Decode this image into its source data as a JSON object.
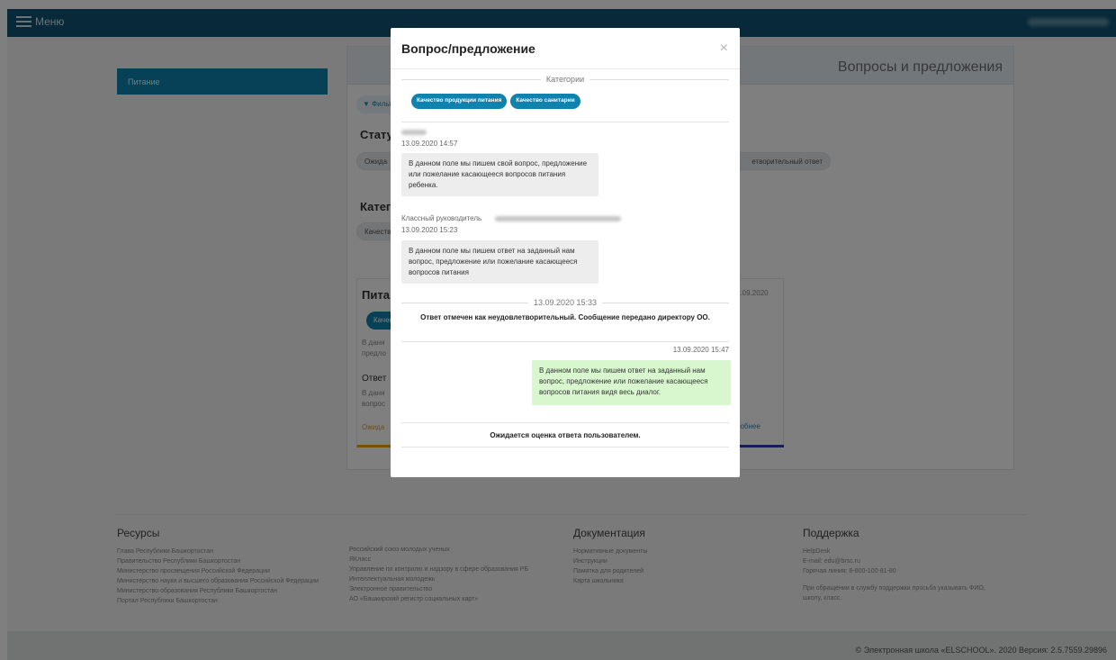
{
  "topbar": {
    "menu_label": "Меню"
  },
  "sidebar": {
    "items": [
      {
        "label": "Питание"
      }
    ]
  },
  "background": {
    "panel_title": "Вопросы и предложения",
    "filter_label": "Фильт",
    "status_heading": "Стату",
    "status_pill_left": "Ожида",
    "status_pill_right": "етворительный ответ",
    "category_heading": "Катего",
    "category_pill": "Качеств",
    "card_title": "Пита",
    "card_date": "9.09.2020",
    "card_chip": "Качес",
    "card_text_1": "В данн",
    "card_text_2": "предло",
    "card_answer": "Ответ",
    "card_answer_text_1": "В данн",
    "card_answer_text_2": "вопрос",
    "card_status": "Ожида",
    "card_more": "робнее"
  },
  "modal": {
    "title": "Вопрос/предложение",
    "close_label": "×",
    "categories_label": "Категории",
    "categories": [
      "Качество продукции питания",
      "Качество санитарии"
    ],
    "messages": [
      {
        "author_prefix": "",
        "time": "13.09.2020 14:57",
        "text": "В данном поле мы пишем свой вопрос, предложение или пожелание касающееся вопросов питания ребенка."
      },
      {
        "author_prefix": "Классный руководитель",
        "time": "13.09.2020 15:23",
        "text": "В данном поле мы пишем ответ на заданный нам вопрос, предложение или пожелание касающееся вопросов питания"
      }
    ],
    "system_event": {
      "time": "13.09.2020 15:33",
      "text": "Ответ отмечен как неудовлетворительный. Сообщение передано директору ОО."
    },
    "own_message": {
      "time": "13.09.2020 15:47",
      "text": "В данном поле мы пишем ответ на заданный нам вопрос, предложение или пожелание касающееся вопросов питания видя весь диалог."
    },
    "footer_text": "Ожидается оценка ответа пользователем."
  },
  "footer": {
    "resources": {
      "title": "Ресурсы",
      "links_col1": [
        "Глава Республики Башкортостан",
        "Правительство Республики Башкортостан",
        "Министерство просвещения Российской Федерации",
        "Министерство науки и высшего образования Российской Федерации",
        "Министерство образования Республики Башкортостан",
        "Портал Республики Башкортостан"
      ],
      "links_col2": [
        "Российский союз молодых ученых",
        "ЯКласс",
        "Управление по контролю и надзору в сфере образования РБ",
        "Интеллектуальная молодежь",
        "Электронное правительство",
        "АО «Башкирский регистр социальных карт»"
      ]
    },
    "documentation": {
      "title": "Документация",
      "links": [
        "Нормативные документы",
        "Инструкции",
        "Памятка для родителей",
        "Карта школьника"
      ]
    },
    "support": {
      "title": "Поддержка",
      "helpdesk": "HelpDesk",
      "email": "E-mail: edu@brsc.ru",
      "hotline": "Горячая линия: 8-800-100-81-80",
      "note": "При обращении в службу поддержки просьба указывать ФИО, школу, класс."
    },
    "copyright": "© Электронная школа «ELSCHOOL». 2020 Версия: 2.5.7559.29896"
  }
}
